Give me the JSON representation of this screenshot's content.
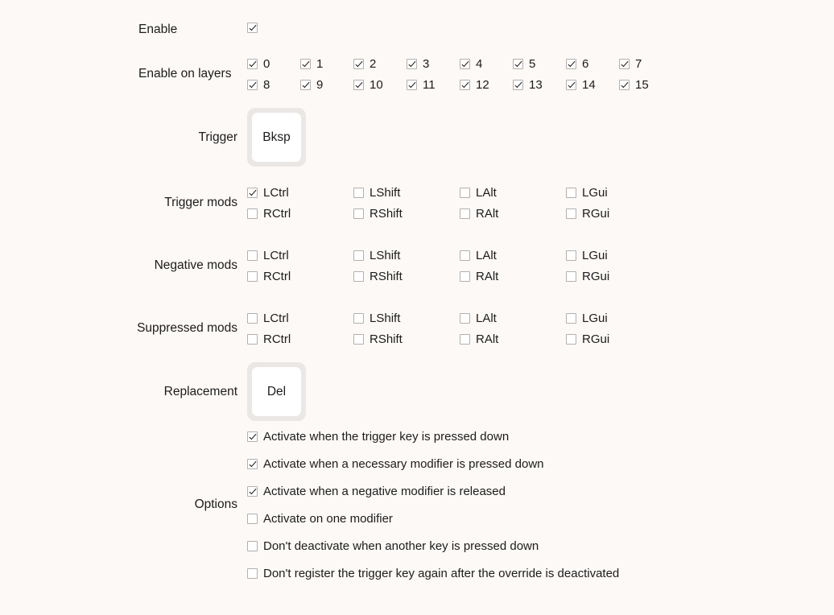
{
  "form": {
    "enable": {
      "label": "Enable",
      "checked": true
    },
    "enable_on_layers": {
      "label": "Enable on layers",
      "layers": [
        {
          "label": "0",
          "checked": true
        },
        {
          "label": "1",
          "checked": true
        },
        {
          "label": "2",
          "checked": true
        },
        {
          "label": "3",
          "checked": true
        },
        {
          "label": "4",
          "checked": true
        },
        {
          "label": "5",
          "checked": true
        },
        {
          "label": "6",
          "checked": true
        },
        {
          "label": "7",
          "checked": true
        },
        {
          "label": "8",
          "checked": true
        },
        {
          "label": "9",
          "checked": true
        },
        {
          "label": "10",
          "checked": true
        },
        {
          "label": "11",
          "checked": true
        },
        {
          "label": "12",
          "checked": true
        },
        {
          "label": "13",
          "checked": true
        },
        {
          "label": "14",
          "checked": true
        },
        {
          "label": "15",
          "checked": true
        }
      ]
    },
    "trigger": {
      "label": "Trigger",
      "key": "Bksp"
    },
    "trigger_mods": {
      "label": "Trigger mods",
      "mods": [
        {
          "label": "LCtrl",
          "checked": true
        },
        {
          "label": "LShift",
          "checked": false
        },
        {
          "label": "LAlt",
          "checked": false
        },
        {
          "label": "LGui",
          "checked": false
        },
        {
          "label": "RCtrl",
          "checked": false
        },
        {
          "label": "RShift",
          "checked": false
        },
        {
          "label": "RAlt",
          "checked": false
        },
        {
          "label": "RGui",
          "checked": false
        }
      ]
    },
    "negative_mods": {
      "label": "Negative mods",
      "mods": [
        {
          "label": "LCtrl",
          "checked": false
        },
        {
          "label": "LShift",
          "checked": false
        },
        {
          "label": "LAlt",
          "checked": false
        },
        {
          "label": "LGui",
          "checked": false
        },
        {
          "label": "RCtrl",
          "checked": false
        },
        {
          "label": "RShift",
          "checked": false
        },
        {
          "label": "RAlt",
          "checked": false
        },
        {
          "label": "RGui",
          "checked": false
        }
      ]
    },
    "suppressed_mods": {
      "label": "Suppressed mods",
      "mods": [
        {
          "label": "LCtrl",
          "checked": false
        },
        {
          "label": "LShift",
          "checked": false
        },
        {
          "label": "LAlt",
          "checked": false
        },
        {
          "label": "LGui",
          "checked": false
        },
        {
          "label": "RCtrl",
          "checked": false
        },
        {
          "label": "RShift",
          "checked": false
        },
        {
          "label": "RAlt",
          "checked": false
        },
        {
          "label": "RGui",
          "checked": false
        }
      ]
    },
    "replacement": {
      "label": "Replacement",
      "key": "Del"
    },
    "options": {
      "label": "Options",
      "items": [
        {
          "label": "Activate when the trigger key is pressed down",
          "checked": true
        },
        {
          "label": "Activate when a necessary modifier is pressed down",
          "checked": true
        },
        {
          "label": "Activate when a negative modifier is released",
          "checked": true
        },
        {
          "label": "Activate on one modifier",
          "checked": false
        },
        {
          "label": "Don't deactivate when another key is pressed down",
          "checked": false
        },
        {
          "label": "Don't register the trigger key again after the override is deactivated",
          "checked": false
        }
      ]
    }
  },
  "colors": {
    "background": "#FCF9F6",
    "key_outer": "#EAE7E4",
    "key_inner": "#FFFFFF",
    "checkbox_border": "#B3B0AD",
    "text": "#1C1C1C"
  }
}
